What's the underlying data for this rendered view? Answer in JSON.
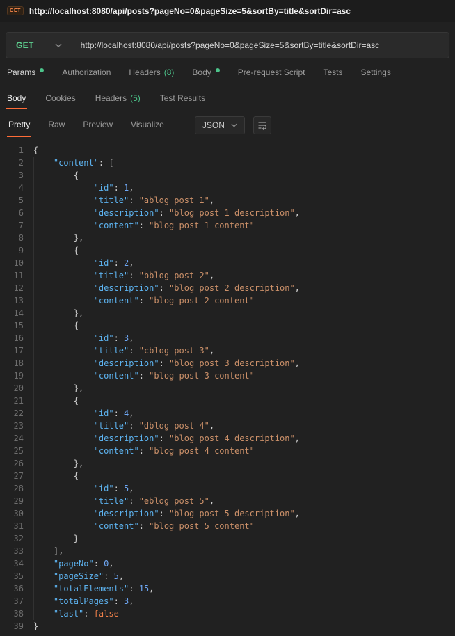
{
  "window": {
    "tab_icon": "GET",
    "tab_title": "http://localhost:8080/api/posts?pageNo=0&pageSize=5&sortBy=title&sortDir=asc"
  },
  "request": {
    "method": "GET",
    "url": "http://localhost:8080/api/posts?pageNo=0&pageSize=5&sortBy=title&sortDir=asc",
    "tabs": [
      {
        "label": "Params",
        "dot": true
      },
      {
        "label": "Authorization"
      },
      {
        "label": "Headers",
        "count": "(8)"
      },
      {
        "label": "Body",
        "dot": true
      },
      {
        "label": "Pre-request Script"
      },
      {
        "label": "Tests"
      },
      {
        "label": "Settings"
      }
    ]
  },
  "response": {
    "tabs": [
      {
        "label": "Body",
        "active": true
      },
      {
        "label": "Cookies"
      },
      {
        "label": "Headers",
        "count": "(5)"
      },
      {
        "label": "Test Results"
      }
    ],
    "view_tabs": [
      {
        "label": "Pretty",
        "active": true
      },
      {
        "label": "Raw"
      },
      {
        "label": "Preview"
      },
      {
        "label": "Visualize"
      }
    ],
    "format": "JSON",
    "body": {
      "content": [
        {
          "id": 1,
          "title": "ablog post 1",
          "description": "blog post 1 description",
          "content": "blog post 1 content"
        },
        {
          "id": 2,
          "title": "bblog post 2",
          "description": "blog post 2 description",
          "content": "blog post 2 content"
        },
        {
          "id": 3,
          "title": "cblog post 3",
          "description": "blog post 3 description",
          "content": "blog post 3 content"
        },
        {
          "id": 4,
          "title": "dblog post 4",
          "description": "blog post 4 description",
          "content": "blog post 4 content"
        },
        {
          "id": 5,
          "title": "eblog post 5",
          "description": "blog post 5 description",
          "content": "blog post 5 content"
        }
      ],
      "pageNo": 0,
      "pageSize": 5,
      "totalElements": 15,
      "totalPages": 3,
      "last": false
    }
  },
  "colors": {
    "accent_orange": "#ff6c37",
    "method_green": "#5ecf8f",
    "count_green": "#4cc38a",
    "key_blue": "#5db3f0",
    "string_orange": "#cb9069",
    "number_blue": "#6fa8f5",
    "boolean_orange": "#ec7f49",
    "punct": "#cfcfcf",
    "line_number": "#6d6d6d"
  }
}
